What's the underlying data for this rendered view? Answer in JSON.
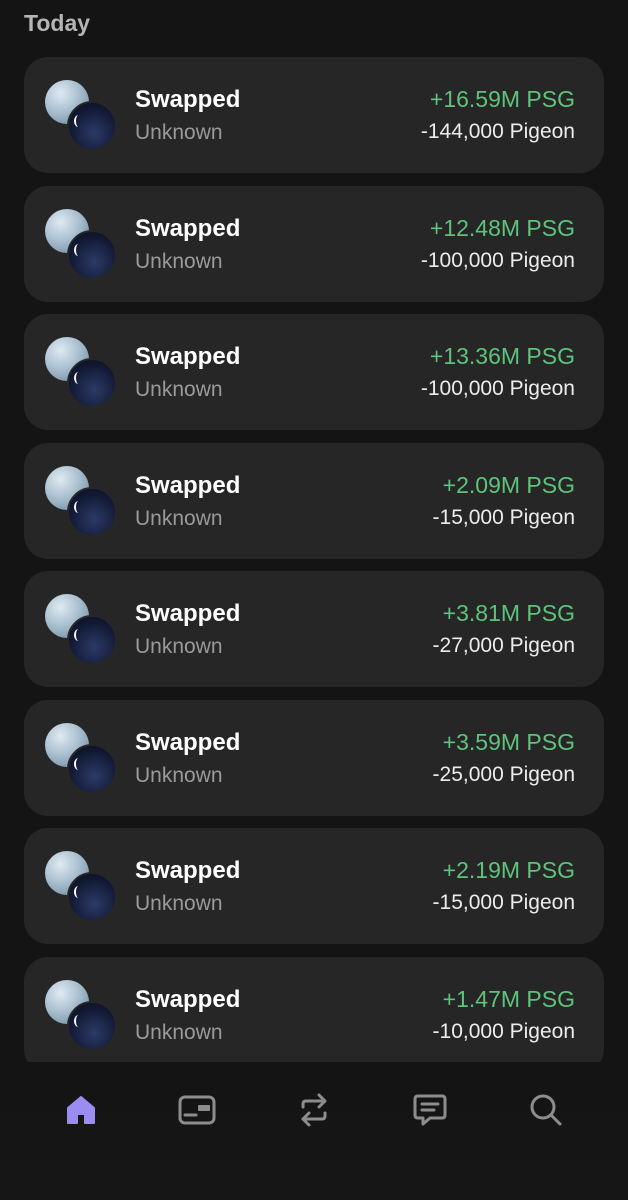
{
  "section": {
    "title": "Today"
  },
  "transactions": [
    {
      "title": "Swapped",
      "subtitle": "Unknown",
      "amount_in": "+16.59M PSG",
      "amount_out": "-144,000 Pigeon"
    },
    {
      "title": "Swapped",
      "subtitle": "Unknown",
      "amount_in": "+12.48M PSG",
      "amount_out": "-100,000 Pigeon"
    },
    {
      "title": "Swapped",
      "subtitle": "Unknown",
      "amount_in": "+13.36M PSG",
      "amount_out": "-100,000 Pigeon"
    },
    {
      "title": "Swapped",
      "subtitle": "Unknown",
      "amount_in": "+2.09M PSG",
      "amount_out": "-15,000 Pigeon"
    },
    {
      "title": "Swapped",
      "subtitle": "Unknown",
      "amount_in": "+3.81M PSG",
      "amount_out": "-27,000 Pigeon"
    },
    {
      "title": "Swapped",
      "subtitle": "Unknown",
      "amount_in": "+3.59M PSG",
      "amount_out": "-25,000 Pigeon"
    },
    {
      "title": "Swapped",
      "subtitle": "Unknown",
      "amount_in": "+2.19M PSG",
      "amount_out": "-15,000 Pigeon"
    },
    {
      "title": "Swapped",
      "subtitle": "Unknown",
      "amount_in": "+1.47M PSG",
      "amount_out": "-10,000 Pigeon"
    }
  ],
  "tabbar": {
    "active_color": "#9b8cf2",
    "inactive_color": "#8d8d8d",
    "items": [
      {
        "icon": "home-icon",
        "active": true
      },
      {
        "icon": "wallet-card-icon",
        "active": false
      },
      {
        "icon": "swap-icon",
        "active": false
      },
      {
        "icon": "chat-icon",
        "active": false
      },
      {
        "icon": "search-icon",
        "active": false
      }
    ]
  },
  "colors": {
    "background": "#141414",
    "card": "#262626",
    "positive": "#5ec37b",
    "section_title": "#b5b5b5",
    "subtitle": "#9a9a9a"
  }
}
